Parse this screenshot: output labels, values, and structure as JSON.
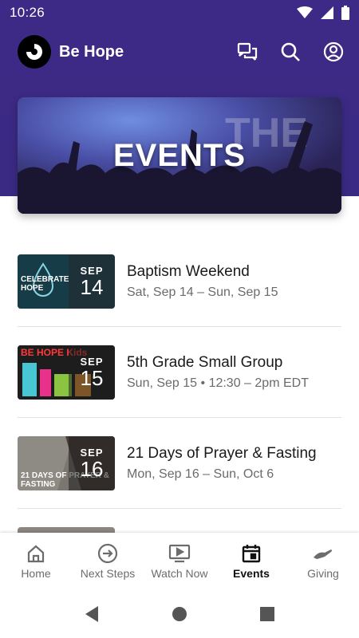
{
  "status": {
    "time": "10:26"
  },
  "app": {
    "title": "Be Hope"
  },
  "banner": {
    "title": "EVENTS"
  },
  "events": [
    {
      "title": "Baptism Weekend",
      "subtitle": "Sat, Sep 14 – Sun, Sep 15",
      "month": "SEP",
      "day": "14",
      "thumb_text": "CELEBRATE HOPE",
      "thumb_color": "#1f4b5a"
    },
    {
      "title": "5th Grade Small Group",
      "subtitle": "Sun, Sep 15 • 12:30 – 2pm EDT",
      "month": "SEP",
      "day": "15",
      "thumb_text": "BE HOPE Kids",
      "thumb_color": "#1d1d1d"
    },
    {
      "title": "21 Days of Prayer & Fasting",
      "subtitle": "Mon, Sep 16 – Sun, Oct 6",
      "month": "SEP",
      "day": "16",
      "thumb_text": "21 DAYS OF PRAYER & FASTING",
      "thumb_color": "#6f6a63"
    }
  ],
  "tabs": [
    {
      "label": "Home",
      "icon": "home-icon"
    },
    {
      "label": "Next Steps",
      "icon": "arrow-circle-icon"
    },
    {
      "label": "Watch Now",
      "icon": "play-icon"
    },
    {
      "label": "Events",
      "icon": "calendar-icon"
    },
    {
      "label": "Giving",
      "icon": "hand-icon"
    }
  ],
  "colors": {
    "header": "#3d2a86",
    "active_tab": "#111111",
    "inactive_tab": "#6c6c6c"
  }
}
